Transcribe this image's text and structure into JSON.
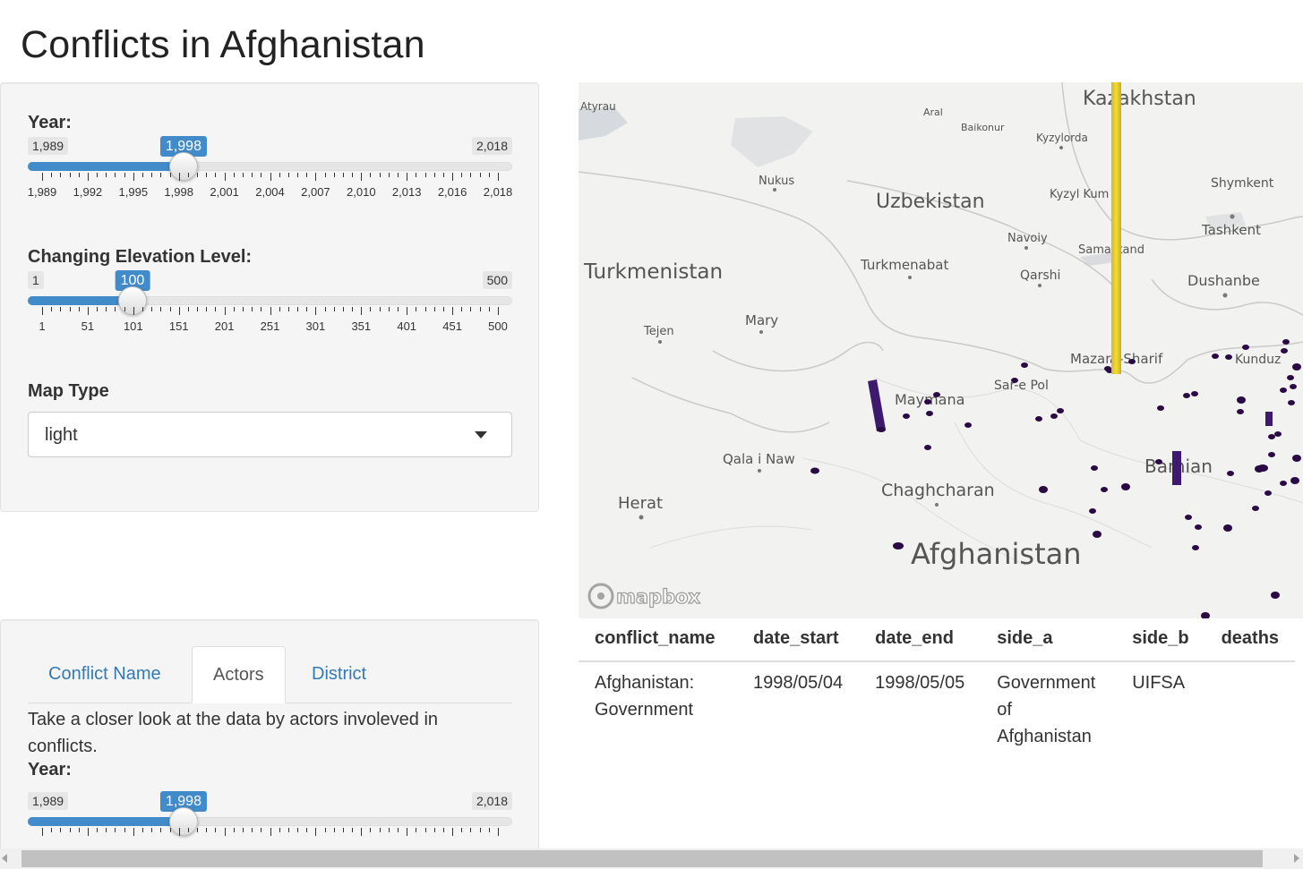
{
  "app": {
    "title": "Conflicts in Afghanistan"
  },
  "controls": {
    "year": {
      "label": "Year:",
      "min": "1,989",
      "max": "2,018",
      "value": "1,998",
      "value_num": 1998,
      "min_num": 1989,
      "max_num": 2018,
      "ticks": [
        "1,989",
        "1,992",
        "1,995",
        "1,998",
        "2,001",
        "2,004",
        "2,007",
        "2,010",
        "2,013",
        "2,016",
        "2,018"
      ]
    },
    "elevation": {
      "label": "Changing Elevation Level:",
      "min": "1",
      "max": "500",
      "value": "100",
      "value_num": 100,
      "min_num": 1,
      "max_num": 500,
      "ticks": [
        "1",
        "51",
        "101",
        "151",
        "201",
        "251",
        "301",
        "351",
        "401",
        "451",
        "500"
      ]
    },
    "map_type": {
      "label": "Map Type",
      "value": "light"
    }
  },
  "tabs": {
    "items": [
      {
        "label": "Conflict Name",
        "active": false
      },
      {
        "label": "Actors",
        "active": true
      },
      {
        "label": "District",
        "active": false
      }
    ],
    "description": "Take a closer look at the data by actors involeved in conflicts.",
    "year": {
      "label": "Year:",
      "min": "1,989",
      "max": "2,018",
      "value": "1,998",
      "value_num": 1998,
      "min_num": 1989,
      "max_num": 2018
    }
  },
  "map": {
    "attribution": "mapbox",
    "countries": [
      "Kazakhstan",
      "Uzbekistan",
      "Turkmenistan",
      "Afghanistan"
    ],
    "cities": [
      "Atyrau",
      "Aral",
      "Baikonur",
      "Kyzylorda",
      "Nukus",
      "Kyzyl Kum",
      "Shymkent",
      "Navoiy",
      "Samarkand",
      "Tashkent",
      "Turkmenabat",
      "Qarshi",
      "Dushanbe",
      "Mary",
      "Tejen",
      "Mazar-i-Sharif",
      "Kunduz",
      "Sar-e Pol",
      "Maymana",
      "Qala i Naw",
      "Bamian",
      "Chaghcharan",
      "Herat"
    ],
    "colors": {
      "tall_column": "#f0d630",
      "column": "#3d1a6e",
      "dot": "#2a0a45",
      "land": "#f1f1f0",
      "water": "#d5d8dc"
    }
  },
  "table": {
    "columns": [
      "conflict_name",
      "date_start",
      "date_end",
      "side_a",
      "side_b",
      "deaths"
    ],
    "rows": [
      {
        "conflict_name": "Afghanistan: Government",
        "date_start": "1998/05/04",
        "date_end": "1998/05/05",
        "side_a": "Government of Afghanistan",
        "side_b": "UIFSA",
        "deaths": ""
      }
    ]
  }
}
